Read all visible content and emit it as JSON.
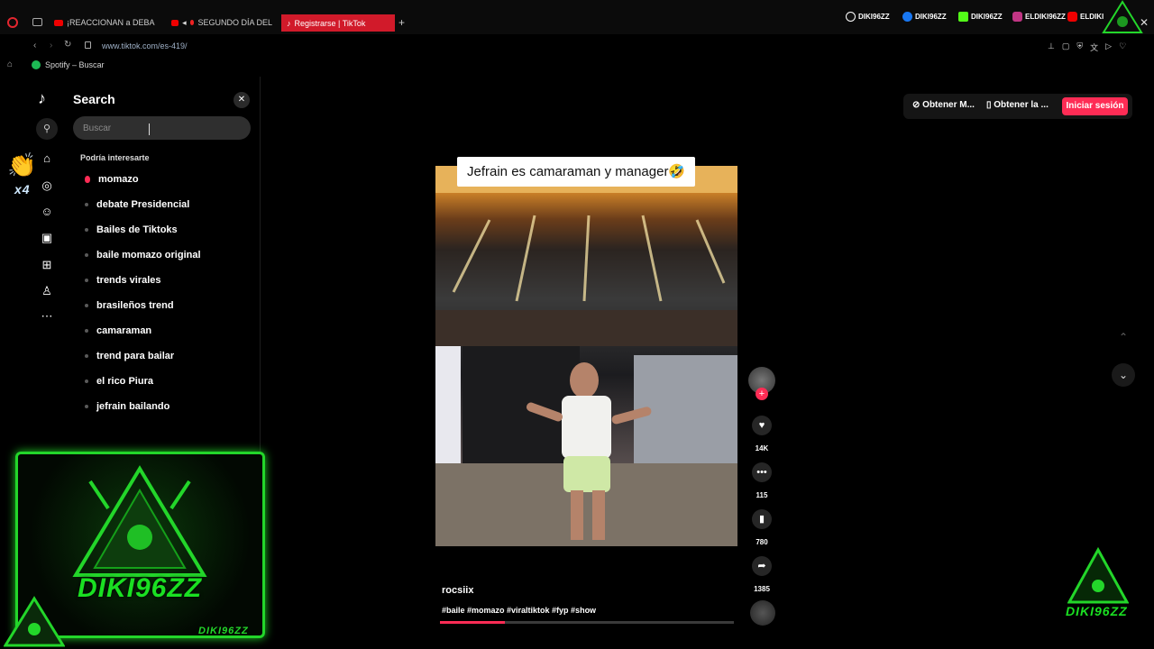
{
  "browser": {
    "tabs": [
      {
        "label": "¡REACCIONAN a DEBA"
      },
      {
        "label": "SEGUNDO DÍA DEL"
      },
      {
        "label": "Registrarse | TikTok"
      }
    ],
    "url": "www.tiktok.com/es-419/",
    "bookmark": "Spotify – Buscar",
    "socials": [
      "DIKI96ZZ",
      "DIKI96ZZ",
      "DIKI96ZZ",
      "ELDIKI96ZZ",
      "ELDIKI"
    ]
  },
  "search": {
    "title": "Search",
    "placeholder": "Buscar",
    "section_label": "Podría interesarte",
    "suggestions": [
      "momazo",
      "debate Presidencial",
      "Bailes de Tiktoks",
      "baile momazo original",
      "trends virales",
      "brasileños trend",
      "camaraman",
      "trend para bailar",
      "el rico Piura",
      "jefrain bailando"
    ]
  },
  "overlay": {
    "brand": "DIKI96ZZ",
    "brand_small": "DIKI96ZZ",
    "x4": "x4"
  },
  "actions": {
    "get_m": "Obtener M...",
    "get_app": "Obtener la ...",
    "login": "Iniciar sesión"
  },
  "video": {
    "caption": "Jefrain es camaraman y manager🤣",
    "author": "rocsiix",
    "hashtags": "#baile #momazo #viraltiktok #fyp #show",
    "likes": "14K",
    "comments": "115",
    "saves": "780",
    "shares": "1385",
    "progress": 0.22
  },
  "colors": {
    "accent": "#fe2c55",
    "overlay_green": "#23d62a"
  }
}
